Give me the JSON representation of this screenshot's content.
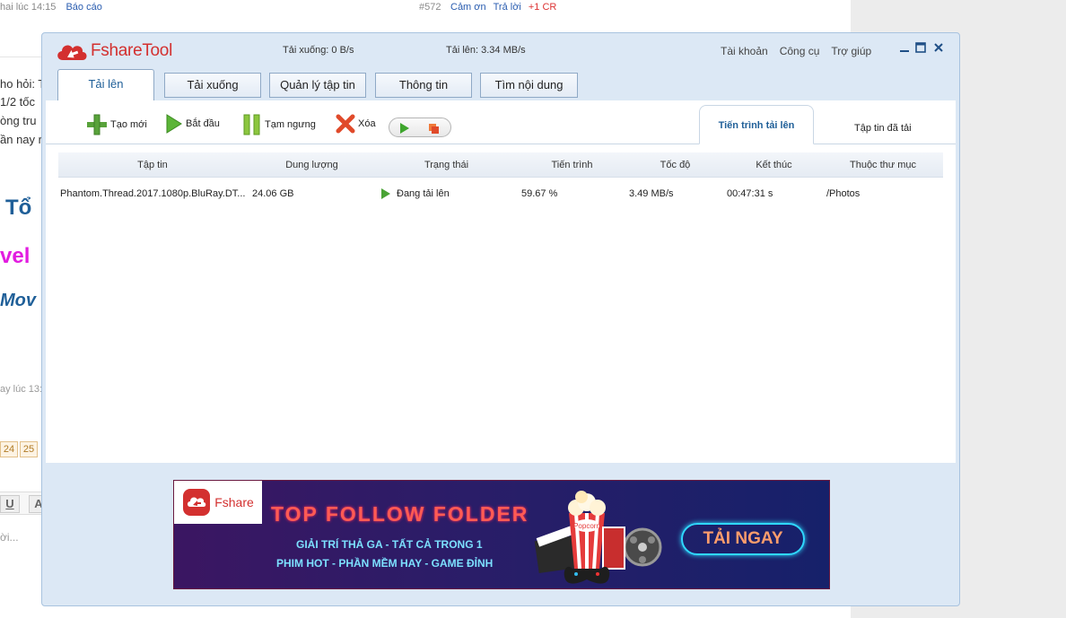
{
  "background_page": {
    "top_meta": "hai lúc 14:15",
    "top_report": "Báo cáo",
    "post_id": "#572",
    "post_actions": [
      "Cảm ơn",
      "Trả lời"
    ],
    "post_reaction": "+1 CR",
    "text_lines": [
      "ho hỏi: T",
      "1/2 tốc",
      "òng tru",
      "ần nay r"
    ],
    "heading_1": "Tổ",
    "heading_2": "vel",
    "heading_3": "Mov",
    "meta_small": "ay lúc 13:0",
    "pages": [
      "24",
      "25"
    ],
    "editor_buttons": [
      "U",
      "A"
    ],
    "reply_placeholder": "ời..."
  },
  "app": {
    "logo_text": "FshareTool",
    "download_speed": "Tải xuống: 0 B/s",
    "upload_speed": "Tải lên: 3.34 MB/s",
    "menu": [
      "Tài khoản",
      "Công cụ",
      "Trợ giúp"
    ],
    "tabs": [
      "Tải lên",
      "Tải xuống",
      "Quản lý tập tin",
      "Thông tin",
      "Tìm nội dung"
    ],
    "toolbar": {
      "new": "Tạo mới",
      "start": "Bắt đầu",
      "pause": "Tạm ngưng",
      "delete": "Xóa"
    },
    "subtabs": [
      "Tiến trình tải lên",
      "Tập tin đã tải"
    ],
    "columns": [
      "Tập tin",
      "Dung lượng",
      "Trạng thái",
      "Tiến trình",
      "Tốc độ",
      "Kết thúc",
      "Thuộc thư mục"
    ],
    "rows": [
      {
        "file": "Phantom.Thread.2017.1080p.BluRay.DT...",
        "size": "24.06 GB",
        "status": "Đang tải lên",
        "progress": "59.67 %",
        "speed": "3.49 MB/s",
        "eta": "00:47:31 s",
        "folder": "/Photos"
      }
    ]
  },
  "banner": {
    "logo_text": "Fshare",
    "title": "TOP FOLLOW FOLDER",
    "line1": "GIẢI TRÍ THẢ GA - TẤT CẢ TRONG 1",
    "line2": "PHIM HOT - PHẦN MỀM HAY - GAME ĐỈNH",
    "cta": "TẢI NGAY",
    "popcorn_label": "Popcorn"
  },
  "colors": {
    "brand": "#d3302f",
    "accent": "#1f5f98",
    "window_bg": "#dce8f5"
  }
}
